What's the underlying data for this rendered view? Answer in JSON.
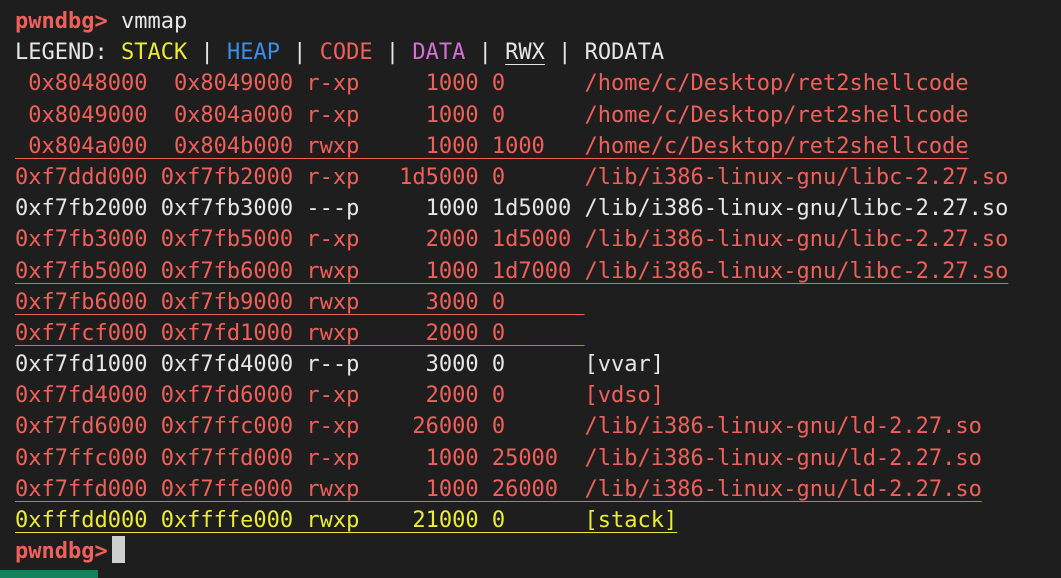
{
  "terminal": {
    "prompt": "pwndbg>",
    "command": " vmmap",
    "legend": {
      "prefix": "LEGEND: ",
      "stack": "STACK",
      "heap": "HEAP",
      "code": "CODE",
      "data": "DATA",
      "rwx": "RWX",
      "rodata": "RODATA",
      "sep": " | "
    },
    "rows": [
      {
        "text": " 0x8048000  0x8049000 r-xp     1000 0      /home/c/Desktop/ret2shellcode",
        "color": "#f0605a",
        "underline": false
      },
      {
        "text": " 0x8049000  0x804a000 r-xp     1000 0      /home/c/Desktop/ret2shellcode",
        "color": "#f0605a",
        "underline": false
      },
      {
        "text": " 0x804a000  0x804b000 rwxp     1000 1000   /home/c/Desktop/ret2shellcode",
        "color": "#f0605a",
        "underline": true
      },
      {
        "text": "0xf7ddd000 0xf7fb2000 r-xp   1d5000 0      /lib/i386-linux-gnu/libc-2.27.so",
        "color": "#f0605a",
        "underline": false
      },
      {
        "text": "0xf7fb2000 0xf7fb3000 ---p     1000 1d5000 /lib/i386-linux-gnu/libc-2.27.so",
        "color": "#e6e6e6",
        "underline": false
      },
      {
        "text": "0xf7fb3000 0xf7fb5000 r-xp     2000 1d5000 /lib/i386-linux-gnu/libc-2.27.so",
        "color": "#f0605a",
        "underline": false
      },
      {
        "text": "0xf7fb5000 0xf7fb6000 rwxp     1000 1d7000 /lib/i386-linux-gnu/libc-2.27.so",
        "color": "#f0605a",
        "underline": true
      },
      {
        "text": "0xf7fb6000 0xf7fb9000 rwxp     3000 0      ",
        "color": "#f0605a",
        "underline": true
      },
      {
        "text": "0xf7fcf000 0xf7fd1000 rwxp     2000 0      ",
        "color": "#f0605a",
        "underline": true
      },
      {
        "text": "0xf7fd1000 0xf7fd4000 r--p     3000 0      [vvar]",
        "color": "#e6e6e6",
        "underline": false
      },
      {
        "text": "0xf7fd4000 0xf7fd6000 r-xp     2000 0      [vdso]",
        "color": "#f0605a",
        "underline": false
      },
      {
        "text": "0xf7fd6000 0xf7ffc000 r-xp    26000 0      /lib/i386-linux-gnu/ld-2.27.so",
        "color": "#f0605a",
        "underline": false
      },
      {
        "text": "0xf7ffc000 0xf7ffd000 r-xp     1000 25000  /lib/i386-linux-gnu/ld-2.27.so",
        "color": "#f0605a",
        "underline": false
      },
      {
        "text": "0xf7ffd000 0xf7ffe000 rwxp     1000 26000  /lib/i386-linux-gnu/ld-2.27.so",
        "color": "#f0605a",
        "underline": true
      },
      {
        "text": "0xfffdd000 0xffffe000 rwxp    21000 0      [stack]",
        "color": "#ecec34",
        "underline": true
      }
    ],
    "final_prompt": "pwndbg>"
  }
}
